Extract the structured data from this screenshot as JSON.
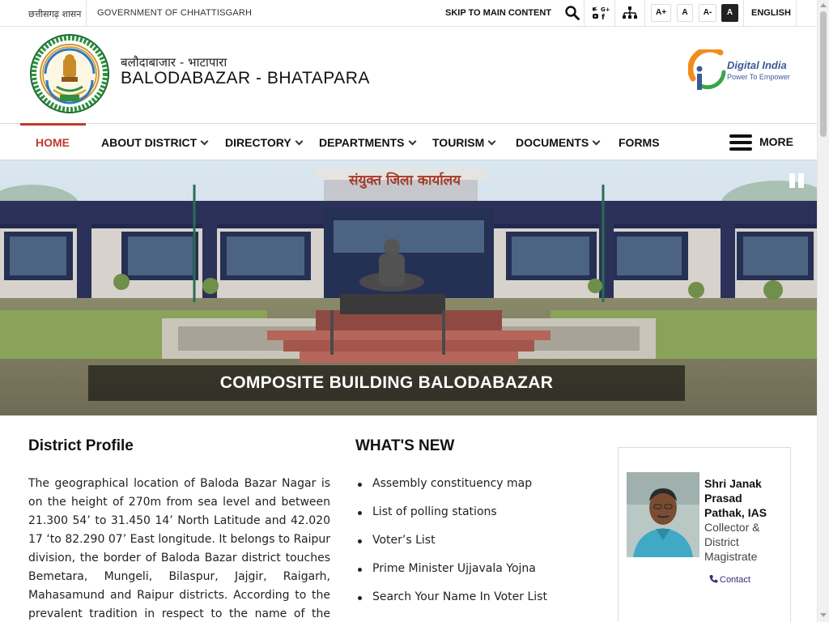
{
  "topbar": {
    "state_label": "छत्तीसगढ़ शासन",
    "government_label": "GOVERNMENT OF CHHATTISGARH",
    "skip_label": "SKIP TO MAIN CONTENT",
    "font_sizes": [
      "A+",
      "A",
      "A-",
      "A"
    ],
    "language_label": "ENGLISH"
  },
  "header": {
    "title_hindi": "बलौदाबाजार - भाटापारा",
    "title_english": "BALODABAZAR - BHATAPARA",
    "digital_india_title": "Digital India",
    "digital_india_tagline": "Power To Empower"
  },
  "nav": {
    "items": [
      {
        "label": "HOME"
      },
      {
        "label": "ABOUT DISTRICT"
      },
      {
        "label": "DIRECTORY"
      },
      {
        "label": "DEPARTMENTS"
      },
      {
        "label": "TOURISM"
      },
      {
        "label": "DOCUMENTS"
      },
      {
        "label": "FORMS"
      }
    ],
    "more_label": "MORE"
  },
  "slider": {
    "banner_text": "संयुक्त जिला कार्यालय",
    "caption": "COMPOSITE BUILDING BALODABAZAR"
  },
  "profile": {
    "title": "District Profile",
    "text": "The geographical location of Baloda Bazar Nagar is on the height of 270m from sea level and between 21.300 54’ to 31.450 14’ North Latitude and 42.020 17 ‘to 82.290 07’ East longitude. It belongs to Raipur division, the border of Baloda Bazar district touches Bemetara, Mungeli, Bilaspur, Jajgir, Raigarh, Mahasamund and Raipur districts. According to the prevalent tradition in respect to the name of the Balauda Bazar, traders of"
  },
  "whats_new": {
    "title": "WHAT'S NEW",
    "items": [
      "Assembly constituency map",
      "List of polling stations",
      "Voter’s List",
      "Prime Minister Ujjavala Yojna",
      "Search Your Name In Voter List"
    ]
  },
  "officer": {
    "name": "Shri Janak Prasad Pathak, IAS",
    "role": "Collector & District Magistrate",
    "contact_label": "Contact"
  },
  "colors": {
    "accent": "#c0392b",
    "nav_text": "#111111",
    "caption_bg": "#000000",
    "link": "#3b2a7a"
  }
}
